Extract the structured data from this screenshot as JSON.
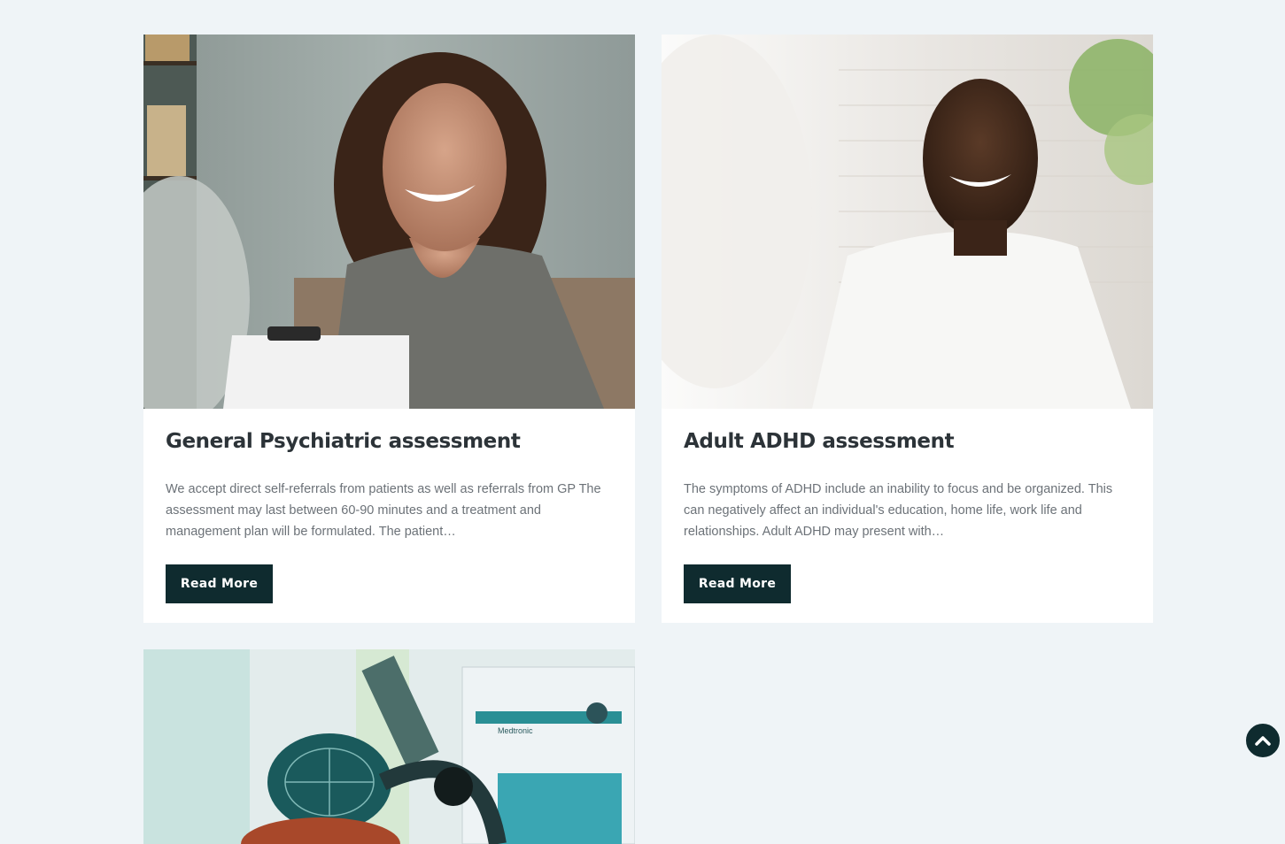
{
  "cards": [
    {
      "title": "General Psychiatric assessment",
      "excerpt": "We accept direct self-referrals from patients as well as referrals from GP The assessment may last between 60-90 minutes and a treatment and management plan will be formulated.  The patient…",
      "button_label": "Read More",
      "image": "smiling-woman-consultation-photo"
    },
    {
      "title": "Adult ADHD assessment",
      "excerpt": "The symptoms of ADHD include an inability to focus and be organized.  This can negatively affect an individual's education, home life, work life and relationships.  Adult ADHD may present with…",
      "button_label": "Read More",
      "image": "smiling-man-consultation-photo"
    },
    {
      "image": "tms-device-treatment-photo",
      "image_text": "Medtronic"
    }
  ],
  "scroll_top": {
    "icon": "chevron-up-icon"
  },
  "colors": {
    "page_background": "#eff4f7",
    "button": "#0f2b2f",
    "title": "#2c3338",
    "body_text": "#6c7278"
  }
}
